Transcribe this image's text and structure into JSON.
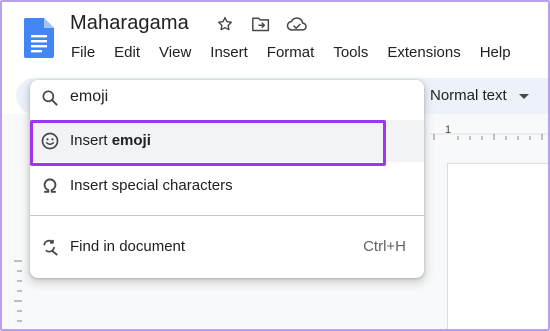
{
  "document": {
    "title": "Maharagama"
  },
  "menubar": {
    "items": [
      "File",
      "Edit",
      "View",
      "Insert",
      "Format",
      "Tools",
      "Extensions",
      "Help"
    ]
  },
  "toolbar": {
    "style_value": "Normal text"
  },
  "ruler": {
    "top_mark": "1"
  },
  "search_menu": {
    "query": "emoji",
    "items": [
      {
        "prefix": "Insert ",
        "bold": "emoji",
        "shortcut": "",
        "icon": "smiley-icon"
      },
      {
        "prefix": "Insert special characters",
        "bold": "",
        "shortcut": "",
        "icon": "omega-icon"
      },
      {
        "prefix": "Find in document",
        "bold": "",
        "shortcut": "Ctrl+H",
        "icon": "find-replace-icon"
      }
    ]
  },
  "colors": {
    "highlight": "#a335e8",
    "frame": "#b9a0ef",
    "docs_blue": "#4285f4",
    "toolbar_bg": "#edf2fa"
  }
}
